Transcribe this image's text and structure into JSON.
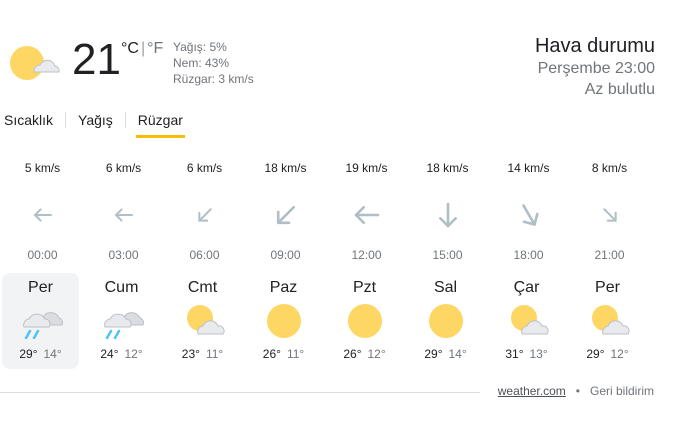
{
  "current": {
    "temp": "21",
    "unit_c": "°C",
    "unit_sep": "|",
    "unit_f": "°F",
    "precip": "Yağış: 5%",
    "humidity": "Nem: 43%",
    "wind": "Rüzgar: 3 km/s",
    "icon": "partly-cloudy-icon"
  },
  "location": {
    "title": "Hava durumu",
    "time": "Perşembe 23:00",
    "condition": "Az bulutlu"
  },
  "tabs": [
    {
      "label": "Sıcaklık",
      "active": false
    },
    {
      "label": "Yağış",
      "active": false
    },
    {
      "label": "Rüzgar",
      "active": true
    }
  ],
  "wind": [
    {
      "speed": "5 km/s",
      "time": "00:00",
      "direction_deg": 270
    },
    {
      "speed": "6 km/s",
      "time": "03:00",
      "direction_deg": 270
    },
    {
      "speed": "6 km/s",
      "time": "06:00",
      "direction_deg": 225
    },
    {
      "speed": "18 km/s",
      "time": "09:00",
      "direction_deg": 225
    },
    {
      "speed": "19 km/s",
      "time": "12:00",
      "direction_deg": 270
    },
    {
      "speed": "18 km/s",
      "time": "15:00",
      "direction_deg": 180
    },
    {
      "speed": "14 km/s",
      "time": "18:00",
      "direction_deg": 150
    },
    {
      "speed": "8 km/s",
      "time": "21:00",
      "direction_deg": 135
    }
  ],
  "days": [
    {
      "name": "Per",
      "hi": "29°",
      "lo": "14°",
      "icon": "rain-cloud-icon",
      "selected": true
    },
    {
      "name": "Cum",
      "hi": "24°",
      "lo": "12°",
      "icon": "rain-cloud-icon",
      "selected": false
    },
    {
      "name": "Cmt",
      "hi": "23°",
      "lo": "11°",
      "icon": "partly-cloudy-icon",
      "selected": false
    },
    {
      "name": "Paz",
      "hi": "26°",
      "lo": "11°",
      "icon": "sunny-icon",
      "selected": false
    },
    {
      "name": "Pzt",
      "hi": "26°",
      "lo": "12°",
      "icon": "sunny-icon",
      "selected": false
    },
    {
      "name": "Sal",
      "hi": "29°",
      "lo": "14°",
      "icon": "sunny-icon",
      "selected": false
    },
    {
      "name": "Çar",
      "hi": "31°",
      "lo": "13°",
      "icon": "partly-cloudy-icon",
      "selected": false
    },
    {
      "name": "Per",
      "hi": "29°",
      "lo": "12°",
      "icon": "partly-cloudy-icon",
      "selected": false
    }
  ],
  "footer": {
    "source": "weather.com",
    "dot": "•",
    "feedback": "Geri bildirim"
  },
  "colors": {
    "sun": "#fdd663",
    "cloud": "#e8eaed",
    "arrow": "#b0bec5",
    "rain": "#4fc3f7",
    "tab_accent": "#fbbc04"
  }
}
